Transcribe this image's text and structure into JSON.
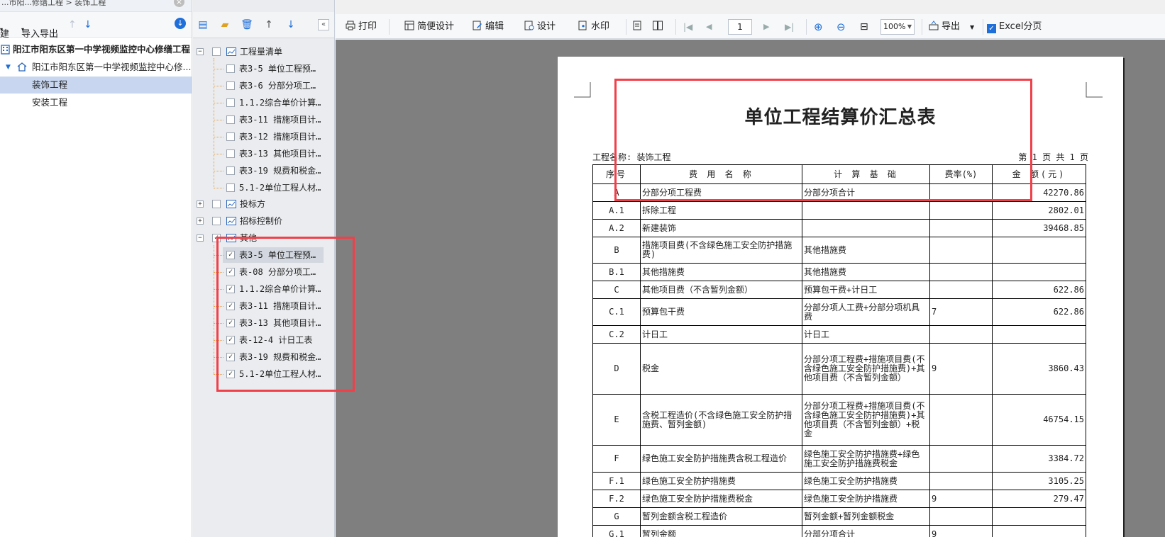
{
  "left_panel": {
    "breadcrumb": "...市阳...修缮工程 > 装饰工程",
    "toolbar": {
      "new_label": "建",
      "import_export_label": "导入导出"
    },
    "tree": [
      {
        "label": "阳江市阳东区第一中学视频监控中心修缮工程",
        "level": 0,
        "bold": true
      },
      {
        "label": "阳江市阳东区第一中学视频监控中心修...",
        "level": 1,
        "bold": false
      },
      {
        "label": "装饰工程",
        "level": 2,
        "selected": true
      },
      {
        "label": "安装工程",
        "level": 2,
        "selected": false
      }
    ]
  },
  "report_tree": {
    "group1": {
      "label": "工程量清单",
      "items": [
        "表3-5 单位工程预…",
        "表3-6 分部分项工…",
        "1.1.2综合单价计算…",
        "表3-11 措施项目计…",
        "表3-12 措施项目计…",
        "表3-13 其他项目计…",
        "表3-19 规费和税金…",
        "5.1-2单位工程人材…"
      ]
    },
    "group2": {
      "label": "投标方"
    },
    "group3": {
      "label": "招标控制价"
    },
    "group4": {
      "label": "其他",
      "items": [
        "表3-5 单位工程预…",
        "表-08 分部分项工…",
        "1.1.2综合单价计算…",
        "表3-11 措施项目计…",
        "表3-13 其他项目计…",
        "表-12-4 计日工表",
        "表3-19 规费和税金…",
        "5.1-2单位工程人材…"
      ]
    }
  },
  "main_toolbar": {
    "print": "打印",
    "simple_design": "简便设计",
    "edit": "编辑",
    "design": "设计",
    "watermark": "水印",
    "page_number": "1",
    "zoom": "100%",
    "export": "导出",
    "excel_paging": "Excel分页",
    "excel_paging_checked": true
  },
  "report": {
    "title": "单位工程结算价汇总表",
    "project_label": "工程名称: 装饰工程",
    "page_info": "第 1 页  共 1 页",
    "headers": [
      "序号",
      "费 用 名 称",
      "计 算 基 础",
      "费率(%)",
      "金  额(元)"
    ],
    "rows": [
      {
        "no": "A",
        "name": "分部分项工程费",
        "basis": "分部分项合计",
        "rate": "",
        "amount": "42270.86"
      },
      {
        "no": "A.1",
        "name": "拆除工程",
        "basis": "",
        "rate": "",
        "amount": "2802.01"
      },
      {
        "no": "A.2",
        "name": "新建装饰",
        "basis": "",
        "rate": "",
        "amount": "39468.85"
      },
      {
        "no": "B",
        "name": "措施项目费(不含绿色施工安全防护措施费)",
        "basis": "其他措施费",
        "rate": "",
        "amount": ""
      },
      {
        "no": "B.1",
        "name": "其他措施费",
        "basis": "其他措施费",
        "rate": "",
        "amount": ""
      },
      {
        "no": "C",
        "name": "其他项目费（不含暂列金额）",
        "basis": "预算包干费+计日工",
        "rate": "",
        "amount": "622.86"
      },
      {
        "no": "C.1",
        "name": "预算包干费",
        "basis": "分部分项人工费+分部分项机具费",
        "rate": "7",
        "amount": "622.86"
      },
      {
        "no": "C.2",
        "name": "计日工",
        "basis": "计日工",
        "rate": "",
        "amount": ""
      },
      {
        "no": "D",
        "name": "税金",
        "basis": "分部分项工程费+措施项目费(不含绿色施工安全防护措施费)+其他项目费（不含暂列金额）",
        "rate": "9",
        "amount": "3860.43"
      },
      {
        "no": "E",
        "name": "含税工程造价(不含绿色施工安全防护措施费、暂列金额)",
        "basis": "分部分项工程费+措施项目费(不含绿色施工安全防护措施费)+其他项目费（不含暂列金额）+税金",
        "rate": "",
        "amount": "46754.15"
      },
      {
        "no": "F",
        "name": "绿色施工安全防护措施费含税工程造价",
        "basis": "绿色施工安全防护措施费+绿色施工安全防护措施费税金",
        "rate": "",
        "amount": "3384.72"
      },
      {
        "no": "F.1",
        "name": "绿色施工安全防护措施费",
        "basis": "绿色施工安全防护措施费",
        "rate": "",
        "amount": "3105.25"
      },
      {
        "no": "F.2",
        "name": "绿色施工安全防护措施费税金",
        "basis": "绿色施工安全防护措施费",
        "rate": "9",
        "amount": "279.47"
      },
      {
        "no": "G",
        "name": "暂列金额含税工程造价",
        "basis": "暂列金额+暂列金额税金",
        "rate": "",
        "amount": ""
      },
      {
        "no": "G.1",
        "name": "暂列金额",
        "basis": "分部分项合计",
        "rate": "9",
        "amount": ""
      }
    ]
  },
  "colors": {
    "highlight": "#f0404a",
    "accent": "#1e6fd9",
    "selection": "#c8d7ef"
  }
}
